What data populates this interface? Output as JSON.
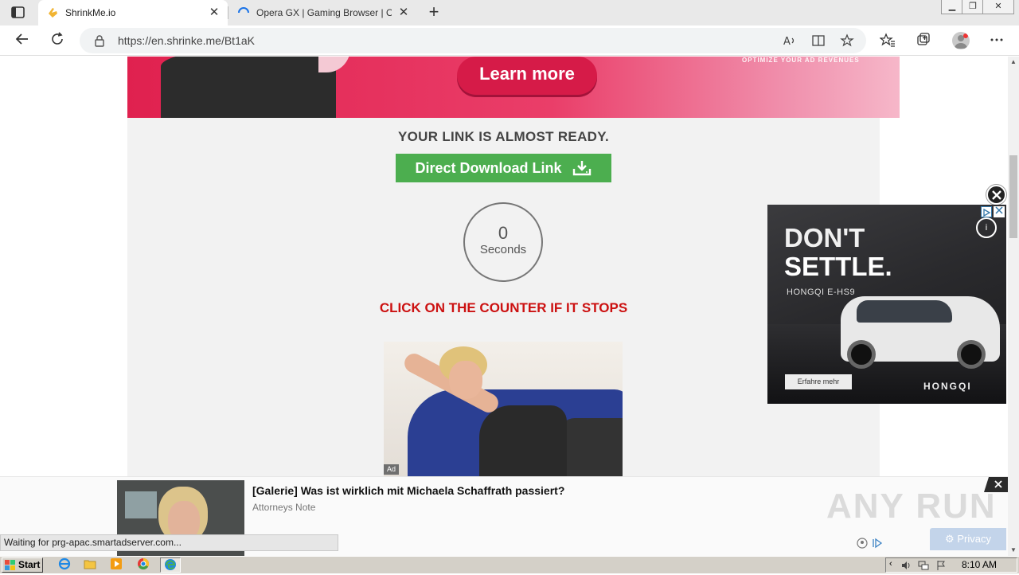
{
  "browser": {
    "tabs": [
      {
        "title": "ShrinkMe.io",
        "active": true
      },
      {
        "title": "Opera GX | Gaming Browser | Ope",
        "active": false
      }
    ],
    "close_glyph": "✕",
    "new_tab_glyph": "+",
    "window_controls": [
      "▁",
      "❐",
      "✕"
    ],
    "url": "https://en.shrinke.me/Bt1aK"
  },
  "banner": {
    "cta": "Learn more",
    "tagline": "OPTIMIZE YOUR AD REVENUES"
  },
  "page": {
    "heading": "YOUR LINK IS ALMOST READY.",
    "download_button": "Direct Download Link",
    "counter_value": "0",
    "counter_label": "Seconds",
    "notice": "CLICK ON THE COUNTER IF IT STOPS",
    "ad_tag": "Ad"
  },
  "side_ad": {
    "line1": "DON'T",
    "line2": "SETTLE.",
    "model": "HONGQI E-HS9",
    "cta": "Erfahre mehr",
    "brand": "HONGQI",
    "info": "i"
  },
  "bottom_ad": {
    "headline": "[Galerie] Was ist wirklich mit Michaela Schaffrath passiert?",
    "source": "Attorneys Note"
  },
  "overlay": {
    "watermark": "ANY RUN",
    "privacy": "Privacy",
    "status": "Waiting for prg-apac.smartadserver.com..."
  },
  "taskbar": {
    "start": "Start",
    "clock": "8:10 AM"
  },
  "colors": {
    "download_green": "#4cae4f",
    "notice_red": "#cc1111",
    "banner_pink": "#e0214f"
  }
}
